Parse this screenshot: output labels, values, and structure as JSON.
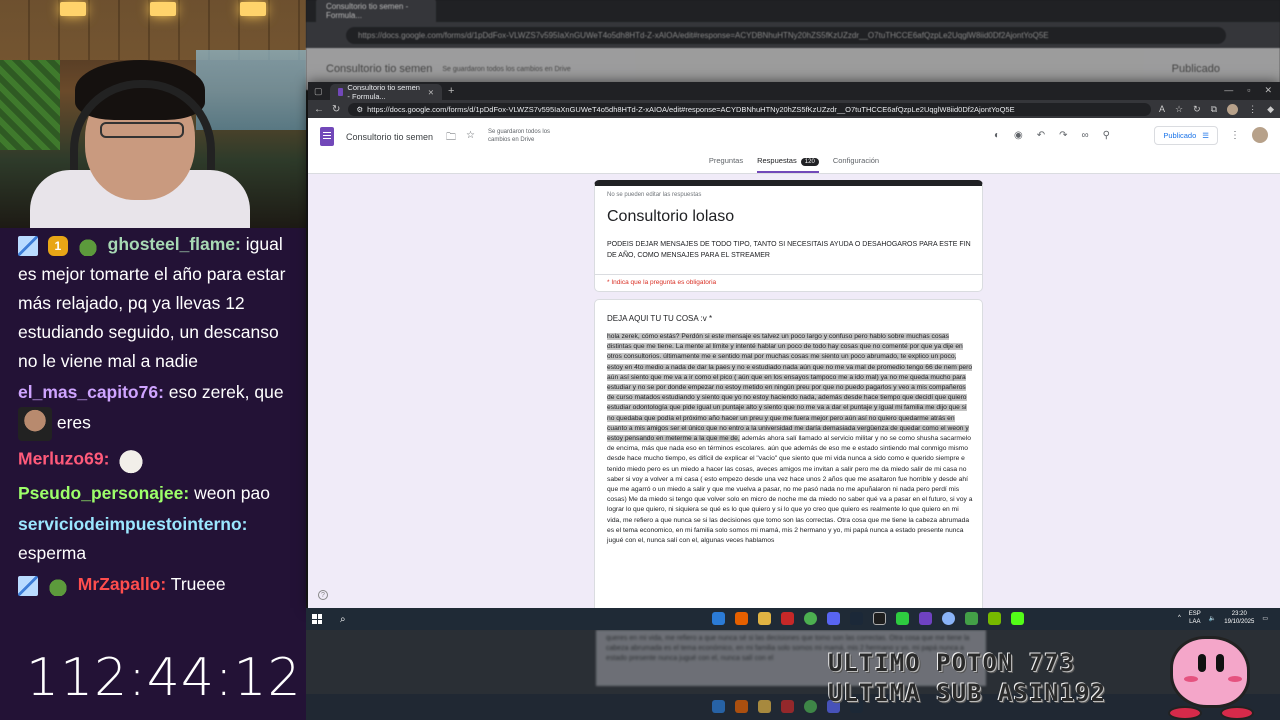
{
  "stream": {
    "timer": "112:44:12"
  },
  "chat": [
    {
      "badges": [
        "sword",
        "gold",
        "frog"
      ],
      "gold_label": "1",
      "user": "ghosteel_flame",
      "color": "#a8d9b4",
      "text": "igual es mejor tomarte el año para estar más relajado, pq ya llevas 12 estudiando seguido, un descanso no le viene mal a nadie"
    },
    {
      "badges": [],
      "user": "el_mas_capito76",
      "color": "#cfa4ff",
      "text_before": "eso zerek, que",
      "emote": "face",
      "text_after": "eres"
    },
    {
      "badges": [],
      "user": "Merluzo69",
      "color": "#ff5a7a",
      "emote": "cat"
    },
    {
      "badges": [],
      "user": "Pseudo_personajee",
      "color": "#9dff6a",
      "text": "weon pao"
    },
    {
      "badges": [],
      "user": "serviciodeimpuestointerno",
      "color": "#9be7ff",
      "text": "esperma"
    },
    {
      "badges": [
        "sword",
        "frog"
      ],
      "user": "MrZapallo",
      "color": "#ff4d4d",
      "text": "Trueee"
    }
  ],
  "bg_browser": {
    "tab": "Consultorio tio semen - Formula...",
    "url": "https://docs.google.com/forms/d/1pDdFox-VLWZS7v595IaXnGUWeT4o5dh8HTd-Z-xAIOA/edit#response=ACYDBNhuHTNy20hZS5fKzUZzdr__O7tuTHCCE6afQzpLe2UqglW8iid0Df2AjontYoQ5E",
    "title": "Consultorio tio semen",
    "saved": "Se guardaron todos los cambios en Drive",
    "publish": "Publicado"
  },
  "browser": {
    "tab_title": "Consultorio tio semen - Formula...",
    "url": "https://docs.google.com/forms/d/1pDdFox-VLWZS7v595IaXnGUWeT4o5dh8HTd-Z-xAIOA/edit#response=ACYDBNhuHTNy20hZS5fKzUZzdr__O7tuTHCCE6afQzpLe2UqglW8iid0Df2AjontYoQ5E",
    "form_title": "Consultorio tio semen",
    "saved": "Se guardaron todos los cambios en Drive",
    "publish": "Publicado",
    "tabs": {
      "preguntas": "Preguntas",
      "respuestas": "Respuestas",
      "count": "120",
      "config": "Configuración"
    }
  },
  "form": {
    "no_edit": "No se pueden editar las respuestas",
    "title": "Consultorio lolaso",
    "description": "PODEIS DEJAR MENSAJES DE TODO TIPO, TANTO SI NECESITAIS AYUDA O DESAHOGAROS PARA ESTE FIN DE AÑO, COMO MENSAJES PARA EL STREAMER",
    "required": "* Indica que la pregunta es obligatoria",
    "question": "DEJA AQUI TU TU COSA :v *",
    "answer_highlighted": "hola zerek, cómo estás? Perdón si este mensaje es talvez un poco largo y confuso pero hablo sobre muchas cosas distintas que me tiene. La mente al límite y intenté hablar un poco de todo hay cosas que no comenté por que ya dije en otros consultorios. últimamente me e sentido mal por muchas cosas me siento un poco abrumado, te explico un poco, estoy en 4to medio a nada de dar la paes y no e estudiado nada aún que no me va mal de promedio tengo 66 de nem pero aún así siento que me va a ir como el pico ( aún que en los ensayos tampoco me a ido mal) ya no me queda mucho para estudiar y no se por donde empezar no estoy metido en ningún preu por que no puedo pagarlos y veo a mis compañeros de curso matados estudiando y siento que yo no estoy haciendo nada, además desde hace tiempo que decidí que quiero estudiar odontología que pide igual un puntaje alto y siento que no me va a dar el puntaje y igual mi familia me dijo que si no quedaba que podía el próximo año hacer un preu y que me fuera mejor pero aún así no quiero quedarme atrás en cuanto a mis amigos ser el único que no entro a la universidad me daría demasiada vergüenza de quedar como el weon y estoy pensando en meterme a la que me de,",
    "answer_rest": " además ahora salí llamado al servicio militar y no se como shusha sacarmelo de encima, más que nada eso en términos escolares. aún que además de eso me e estado sintiendo mal conmigo mismo desde hace mucho tiempo, es difícil de explicar el \"vacío\" que siento que mi vida nunca a sido como e querido siempre e tenido miedo pero es un miedo a hacer las cosas, aveces amigos me invitan a salir pero me da miedo salir de mi casa no saber si voy a volver a mi casa ( esto empezo desde una vez hace unos 2 años que me asaltaron fue horrible y desde ahí que me agarró o un miedo a salir y que me vuelva a pasar, no me pasó nada no me apuñalaron ni nada pero perdí mis cosas) Me da miedo si tengo que volver solo en micro de noche me da miedo no saber qué va a pasar en el futuro, si voy a lograr lo que quiero, ni siquiera se qué es lo que quiero y si lo que yo creo que quiero es realmente lo que quiero en mi vida, me refiero a que nunca se si las decisiones que tomo son las correctas. Otra cosa que me tiene la cabeza abrumada es el tema economico, en mi familia solo somos mi mamá, mis 2 hermano y yo, mi papá nunca a estado presente nunca jugué con el, nunca salí con el, algunas veces hablamos"
  },
  "taskbar": {
    "lang": "ESP\nLAA",
    "time": "23:20",
    "date": "19/10/2025"
  },
  "goals": {
    "line1": "ULTIMO POTON 773",
    "line2": "ULTIMA SUB ASIN192"
  },
  "bottom_blur": "queres en mi vida, me refiero a que nunca sé si las decisiones que tomo son las correctas. Otra cosa que me tiene la cabeza abrumada es el tema económico, en mi familia solo somos mi mamá, mis 2 hermano y yo, mi papá nunca a estado presente nunca jugué con el, nunca salí con el"
}
